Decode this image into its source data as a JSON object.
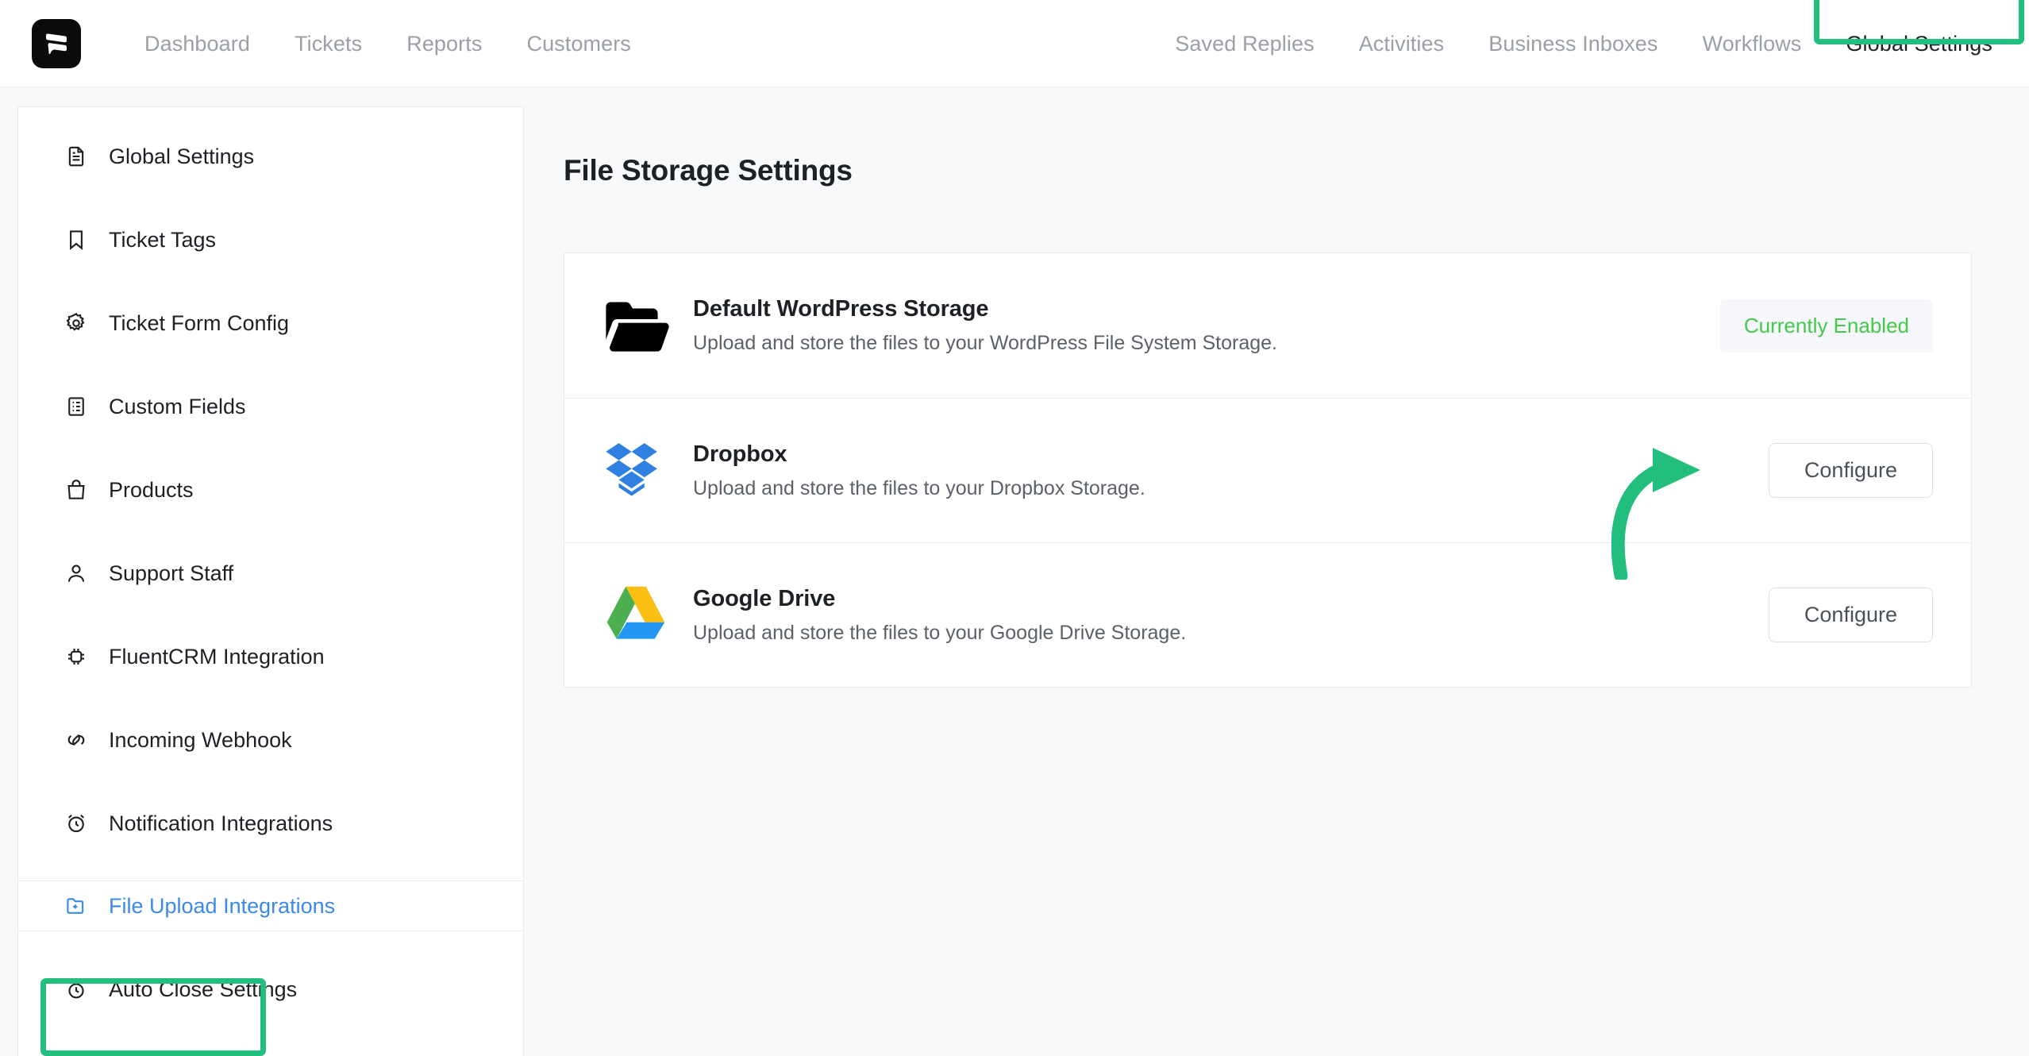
{
  "colors": {
    "annotation_green": "#21be7e",
    "active_blue": "#3b8ae8",
    "enabled_green": "#44c94a",
    "nav_inactive": "#9b9fa6"
  },
  "topbar": {
    "logo_name": "fluent-support-logo",
    "nav_left": [
      {
        "label": "Dashboard",
        "active": false
      },
      {
        "label": "Tickets",
        "active": false
      },
      {
        "label": "Reports",
        "active": false
      },
      {
        "label": "Customers",
        "active": false
      }
    ],
    "nav_right": [
      {
        "label": "Saved Replies",
        "active": false
      },
      {
        "label": "Activities",
        "active": false
      },
      {
        "label": "Business Inboxes",
        "active": false
      },
      {
        "label": "Workflows",
        "active": false
      },
      {
        "label": "Global Settings",
        "active": true,
        "annotated": true
      }
    ]
  },
  "sidebar": {
    "items": [
      {
        "label": "Global Settings",
        "icon": "document-icon",
        "active": false
      },
      {
        "label": "Ticket Tags",
        "icon": "bookmark-icon",
        "active": false
      },
      {
        "label": "Ticket Form Config",
        "icon": "gear-icon",
        "active": false
      },
      {
        "label": "Custom Fields",
        "icon": "list-document-icon",
        "active": false
      },
      {
        "label": "Products",
        "icon": "shopping-bag-icon",
        "active": false
      },
      {
        "label": "Support Staff",
        "icon": "user-icon",
        "active": false
      },
      {
        "label": "FluentCRM Integration",
        "icon": "chip-icon",
        "active": false
      },
      {
        "label": "Incoming Webhook",
        "icon": "link-icon",
        "active": false
      },
      {
        "label": "Notification Integrations",
        "icon": "alarm-clock-icon",
        "active": false
      },
      {
        "label": "File Upload Integrations",
        "icon": "folder-plus-icon",
        "active": true,
        "annotated": true
      },
      {
        "label": "Auto Close Settings",
        "icon": "stopwatch-icon",
        "active": false
      }
    ]
  },
  "main": {
    "page_title": "File Storage Settings",
    "storage_options": [
      {
        "name": "Default WordPress Storage",
        "description": "Upload and store the files to your WordPress File System Storage.",
        "logo": "folder-icon",
        "action_type": "badge",
        "action_label": "Currently Enabled"
      },
      {
        "name": "Dropbox",
        "description": "Upload and store the files to your Dropbox Storage.",
        "logo": "dropbox-logo",
        "action_type": "button",
        "action_label": "Configure",
        "annotated": true
      },
      {
        "name": "Google Drive",
        "description": "Upload and store the files to your Google Drive Storage.",
        "logo": "google-drive-logo",
        "action_type": "button",
        "action_label": "Configure"
      }
    ]
  }
}
